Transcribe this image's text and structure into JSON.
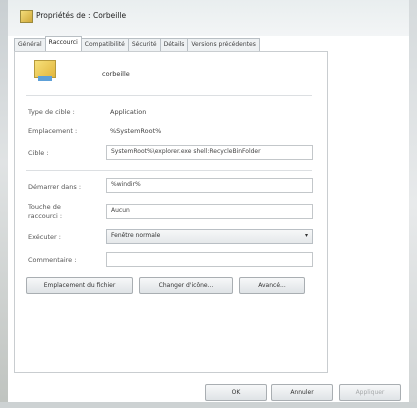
{
  "window": {
    "title": "Propriétés de : Corbeille"
  },
  "tabs": [
    {
      "label": "Général"
    },
    {
      "label": "Raccourci"
    },
    {
      "label": "Compatibilité"
    },
    {
      "label": "Sécurité"
    },
    {
      "label": "Détails"
    },
    {
      "label": "Versions précédentes"
    }
  ],
  "shortcut": {
    "name": "corbeille",
    "target_type_label": "Type de cible :",
    "target_type_value": "Application",
    "location_label": "Emplacement :",
    "location_value": "%SystemRoot%",
    "target_label": "Cible :",
    "target_value": "SystemRoot%\\explorer.exe shell:RecycleBinFolder",
    "start_in_label": "Démarrer dans :",
    "start_in_value": "%windir%",
    "shortcut_key_label_1": "Touche de",
    "shortcut_key_label_2": "raccourci :",
    "shortcut_key_value": "Aucun",
    "run_label": "Exécuter :",
    "run_value": "Fenêtre normale",
    "comment_label": "Commentaire :",
    "comment_value": ""
  },
  "buttons": {
    "open_location": "Emplacement du fichier",
    "change_icon": "Changer d'icône...",
    "advanced": "Avancé...",
    "ok": "OK",
    "cancel": "Annuler",
    "apply": "Appliquer"
  },
  "icons": {
    "window_icon": "recycle-bin-icon",
    "dropdown_arrow": "▾"
  }
}
